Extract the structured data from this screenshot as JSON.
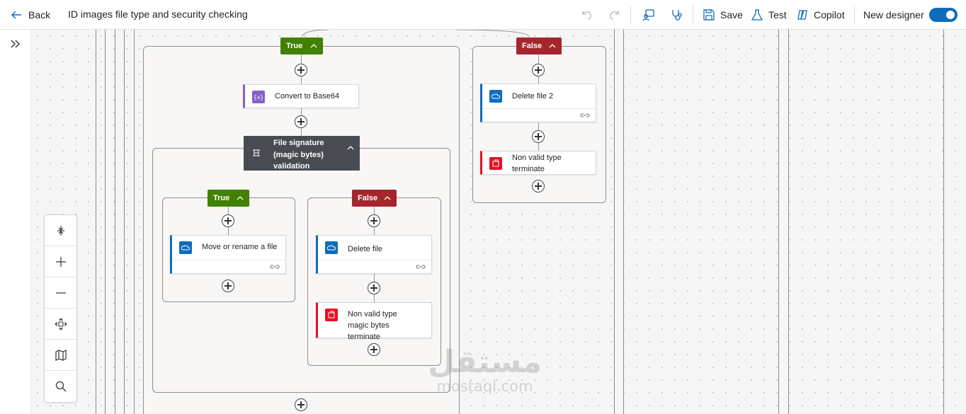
{
  "header": {
    "back_label": "Back",
    "title": "ID images file type and security checking",
    "save_label": "Save",
    "test_label": "Test",
    "copilot_label": "Copilot",
    "new_designer_label": "New designer"
  },
  "flow": {
    "outer_true_label": "True",
    "outer_false_label": "False",
    "convert_label": "Convert to Base64",
    "scope_label": "File signature (magic bytes) validation",
    "inner_true_label": "True",
    "inner_false_label": "False",
    "move_label": "Move or rename a file",
    "delete_label": "Delete file",
    "terminate_inner_label": "Non valid type magic bytes terminate",
    "delete2_label": "Delete file 2",
    "terminate_outer_label": "Non valid type terminate"
  },
  "watermark": {
    "arabic": "مستقل",
    "latin": "mostaql.com"
  },
  "colors": {
    "true_branch": "#428000",
    "false_branch": "#a4262c",
    "accent": "#0f6cbd"
  }
}
